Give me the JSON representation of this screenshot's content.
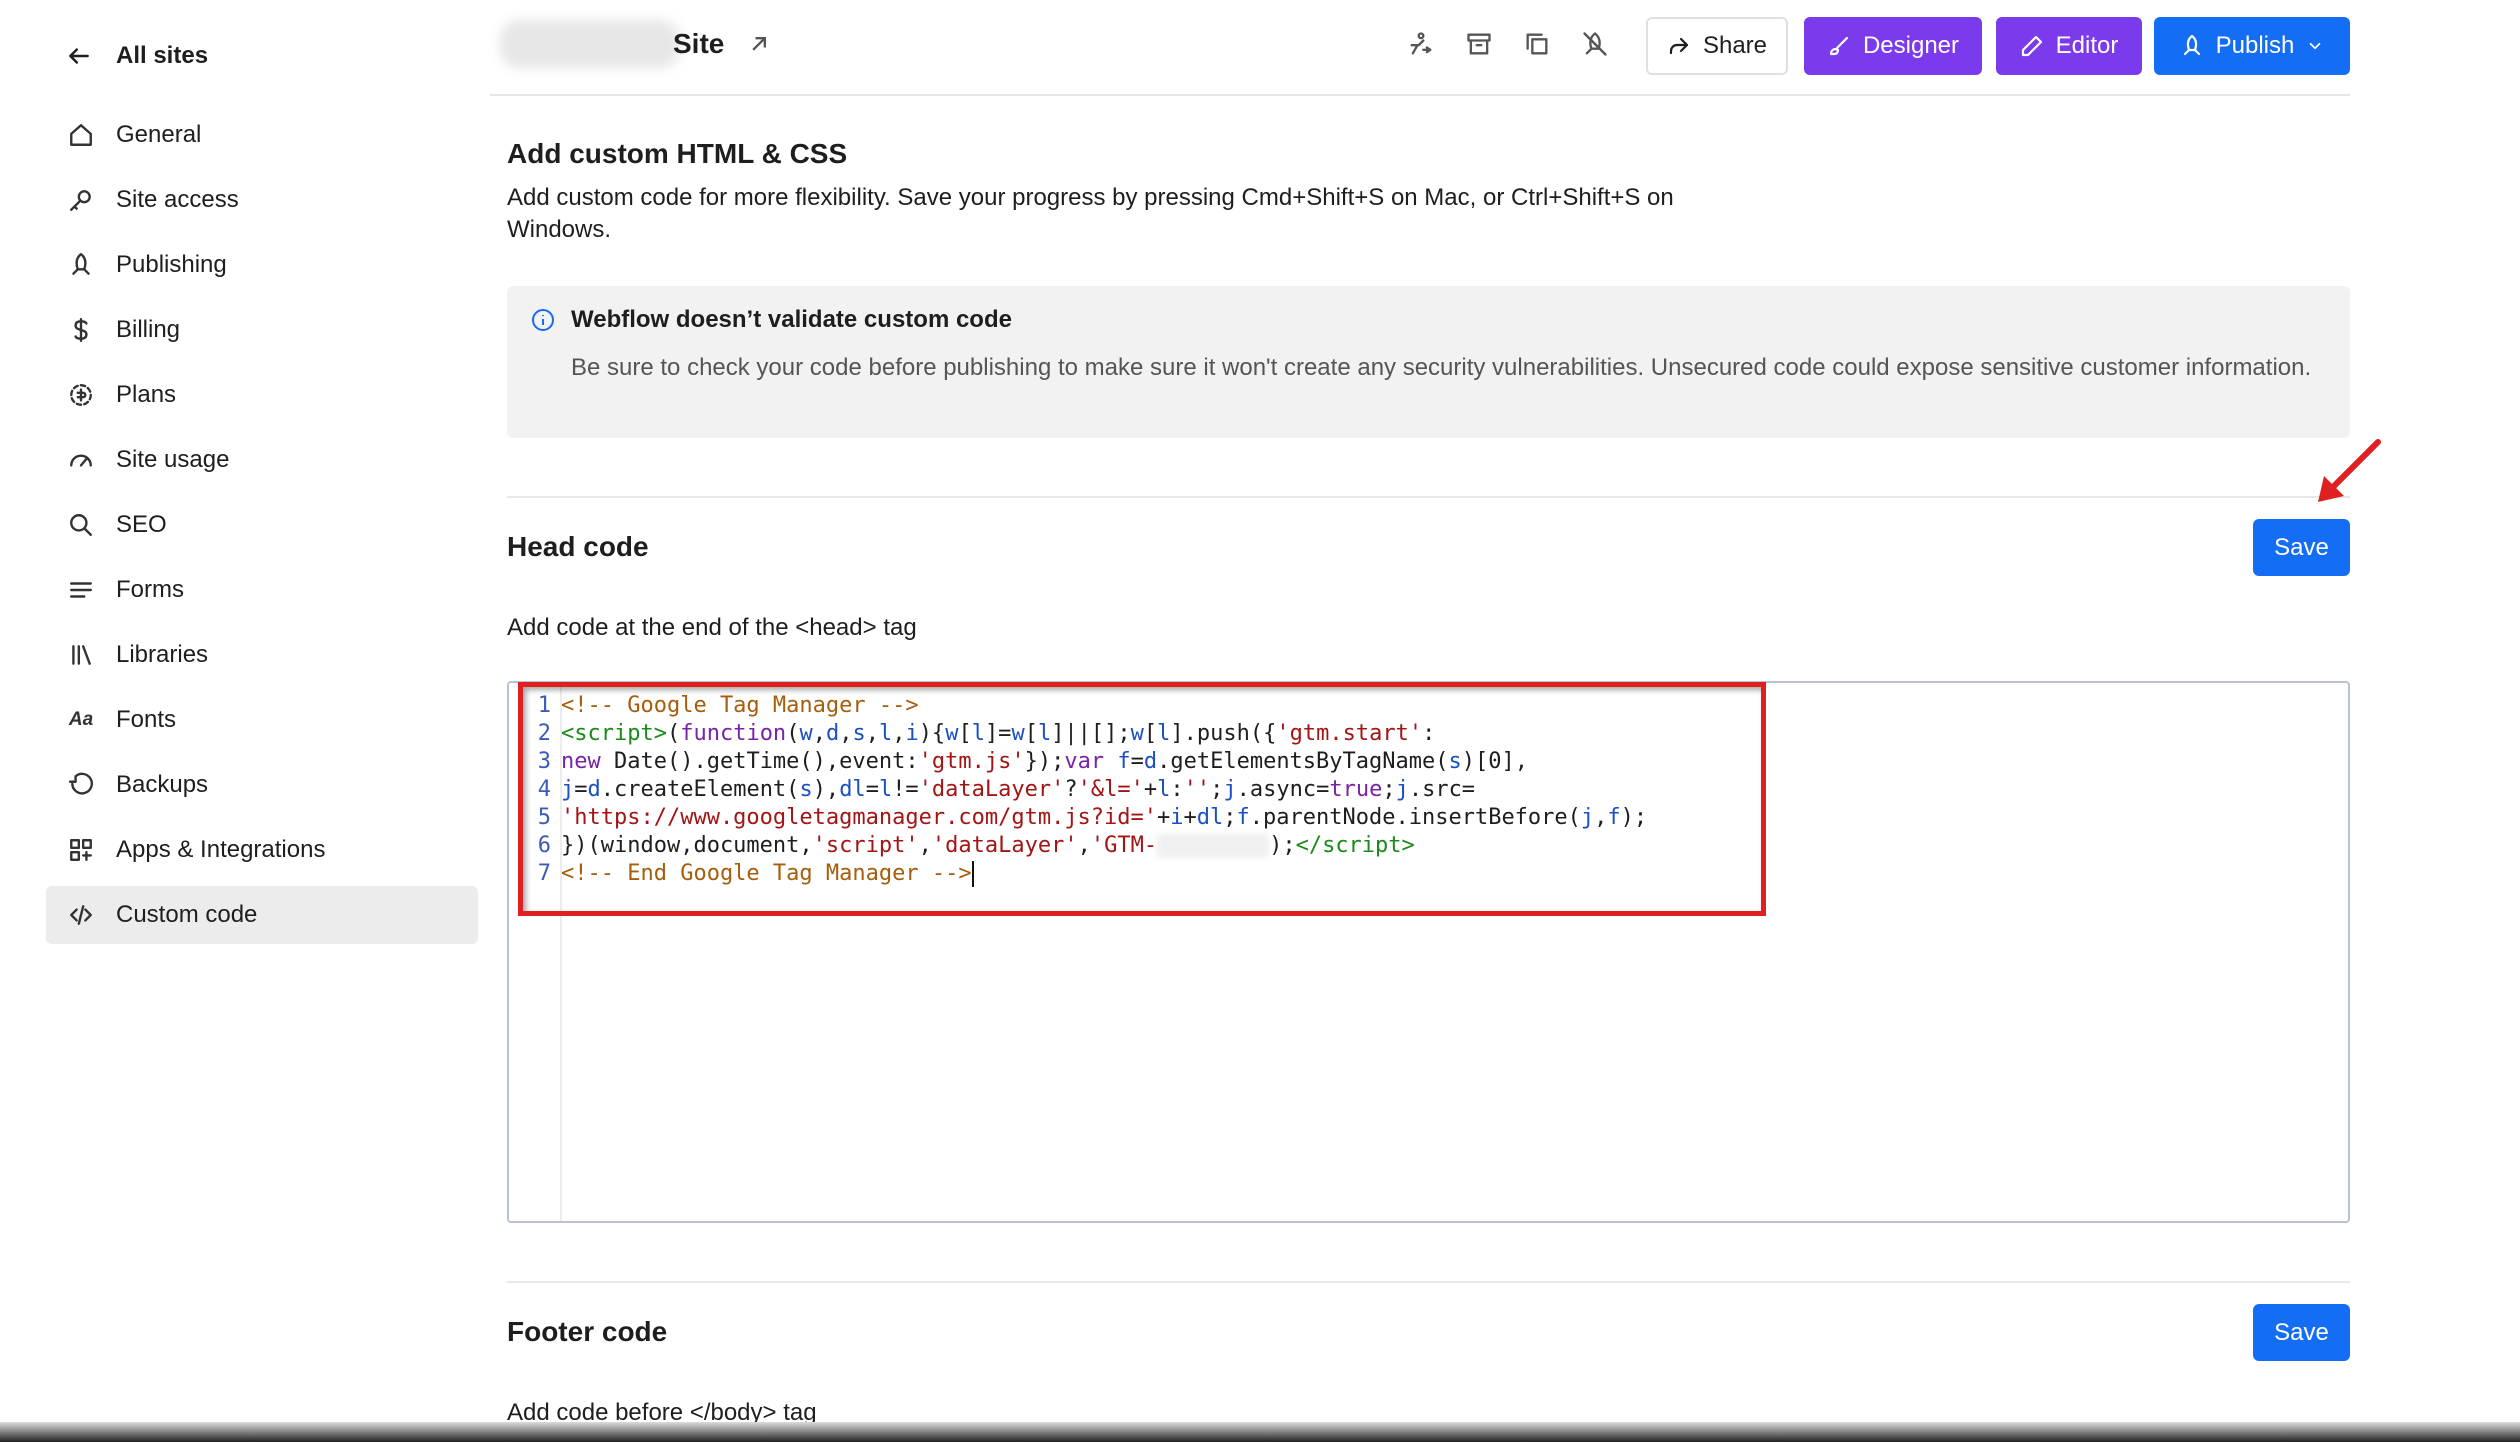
{
  "sidebar": {
    "back_label": "All sites",
    "items": [
      {
        "label": "General",
        "icon": "home-icon"
      },
      {
        "label": "Site access",
        "icon": "key-icon"
      },
      {
        "label": "Publishing",
        "icon": "rocket-icon"
      },
      {
        "label": "Billing",
        "icon": "dollar-icon"
      },
      {
        "label": "Plans",
        "icon": "plans-icon"
      },
      {
        "label": "Site usage",
        "icon": "gauge-icon"
      },
      {
        "label": "SEO",
        "icon": "search-icon"
      },
      {
        "label": "Forms",
        "icon": "forms-icon"
      },
      {
        "label": "Libraries",
        "icon": "library-icon"
      },
      {
        "label": "Fonts",
        "icon": "fonts-icon"
      },
      {
        "label": "Backups",
        "icon": "backup-icon"
      },
      {
        "label": "Apps & Integrations",
        "icon": "apps-icon"
      },
      {
        "label": "Custom code",
        "icon": "code-icon",
        "active": true
      }
    ]
  },
  "header": {
    "site_title": "Site",
    "share_label": "Share",
    "designer_label": "Designer",
    "editor_label": "Editor",
    "publish_label": "Publish"
  },
  "main": {
    "section_title": "Add custom HTML & CSS",
    "section_desc": "Add custom code for more flexibility. Save your progress by pressing Cmd+Shift+S on Mac, or Ctrl+Shift+S on Windows.",
    "note_title": "Webflow doesn’t validate custom code",
    "note_body": "Be sure to check your code before publishing to make sure it won't create any security vulnerabilities. Unsecured code could expose sensitive customer information.",
    "head_title": "Head code",
    "head_save": "Save",
    "head_desc": "Add code at the end of the <head> tag",
    "footer_title": "Footer code",
    "footer_save": "Save",
    "footer_desc": "Add code before </body> tag",
    "code_line_numbers": [
      "1",
      "2",
      "3",
      "4",
      "5",
      "6",
      "7"
    ]
  },
  "colors": {
    "accent": "#146ef5",
    "purple": "#7c3aed",
    "highlight": "#e02020"
  }
}
